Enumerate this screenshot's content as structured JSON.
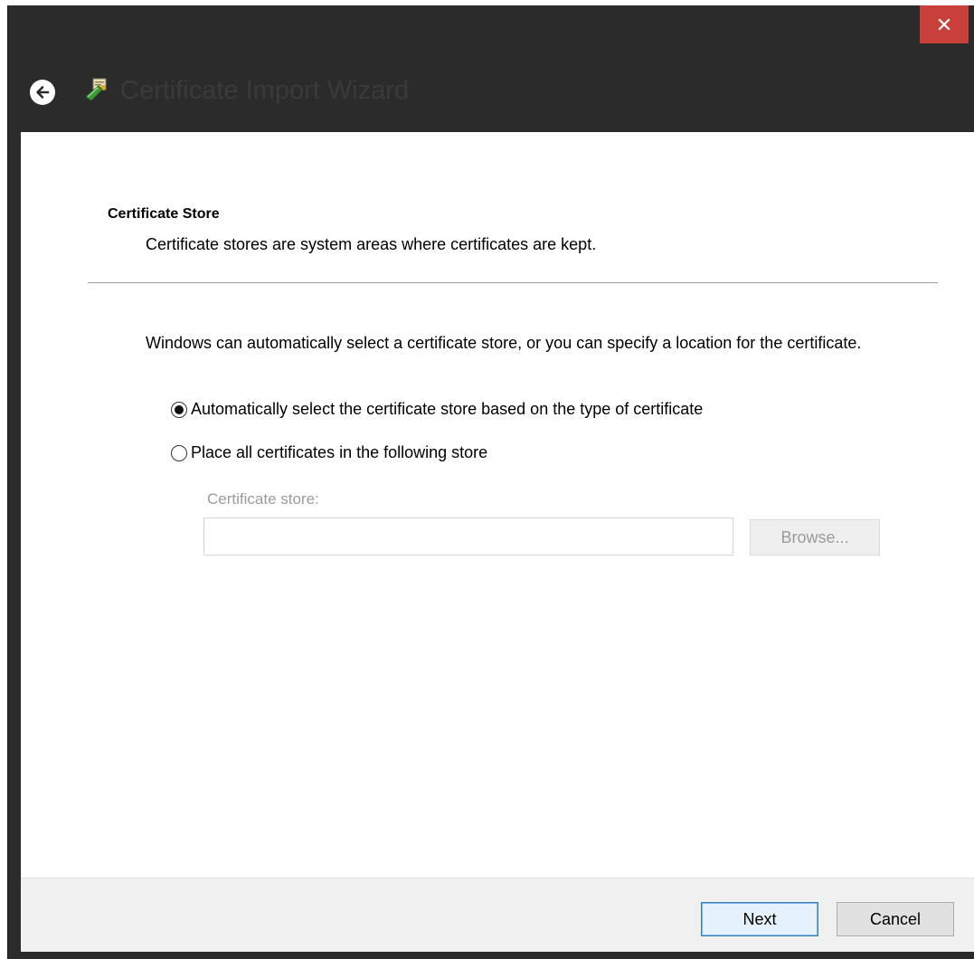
{
  "window": {
    "title": "Certificate Import Wizard"
  },
  "icons": {
    "close": "close-icon",
    "back": "back-arrow-icon",
    "app": "certificate-icon"
  },
  "page": {
    "heading": "Certificate Store",
    "description": "Certificate stores are system areas where certificates are kept.",
    "intro": "Windows can automatically select a certificate store, or you can specify a location for the certificate.",
    "options": [
      {
        "label": "Automatically select the certificate store based on the type of certificate",
        "selected": true
      },
      {
        "label": "Place all certificates in the following store",
        "selected": false
      }
    ],
    "store_label": "Certificate store:",
    "store_value": "",
    "browse_label": "Browse..."
  },
  "footer": {
    "next_label": "Next",
    "cancel_label": "Cancel"
  },
  "colors": {
    "titlebar": "#2b2b2b",
    "close_button": "#c9403a",
    "footer": "#f0f0f0",
    "accent_border": "#3c7fb1"
  }
}
